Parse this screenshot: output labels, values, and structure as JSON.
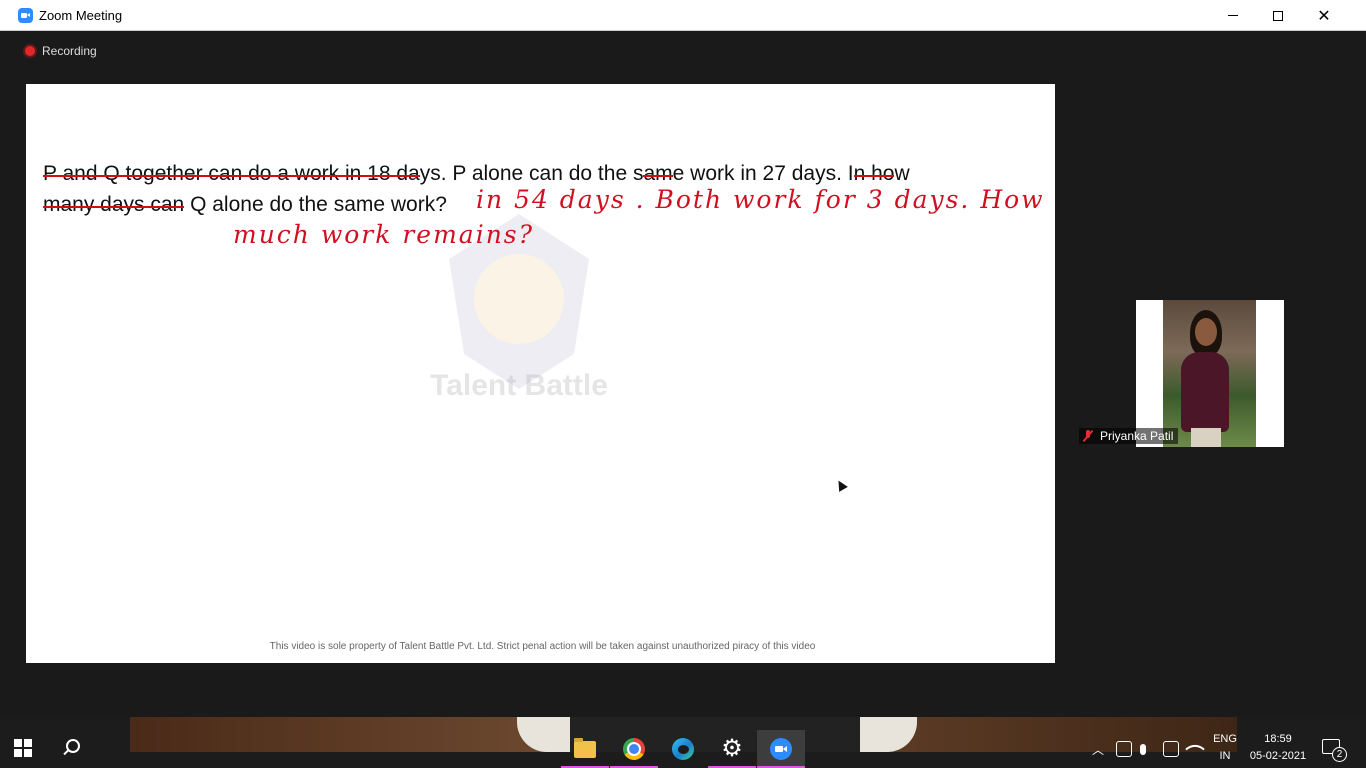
{
  "window": {
    "title": "Zoom Meeting"
  },
  "recording": {
    "label": "Recording"
  },
  "slide": {
    "question_parts": {
      "line1_struck_a": "P and Q together can do a work in 18 da",
      "line1_plain_a": "ys. P alone can do the s",
      "line1_struck_b": "am",
      "line1_plain_b": "e work in 27 days. I",
      "line1_struck_c": "n ho",
      "line1_plain_c": "w",
      "line2_struck_a": "many days can",
      "line2_plain_a": " Q alone do the same work?"
    },
    "annotation_line1": "in 54 days .  Both work for  3 days.  How",
    "annotation_line2": "much  work  remains?",
    "watermark": "Talent Battle",
    "footer": "This video is sole property of Talent Battle Pvt. Ltd. Strict penal action will be taken against unauthorized piracy of this video"
  },
  "participant": {
    "name": "Priyanka Patil"
  },
  "taskbar": {
    "apps": [
      "file-explorer",
      "chrome",
      "edge",
      "settings",
      "zoom"
    ],
    "language": "ENG",
    "region": "IN",
    "time": "18:59",
    "date": "05-02-2021",
    "notifications": "2"
  }
}
